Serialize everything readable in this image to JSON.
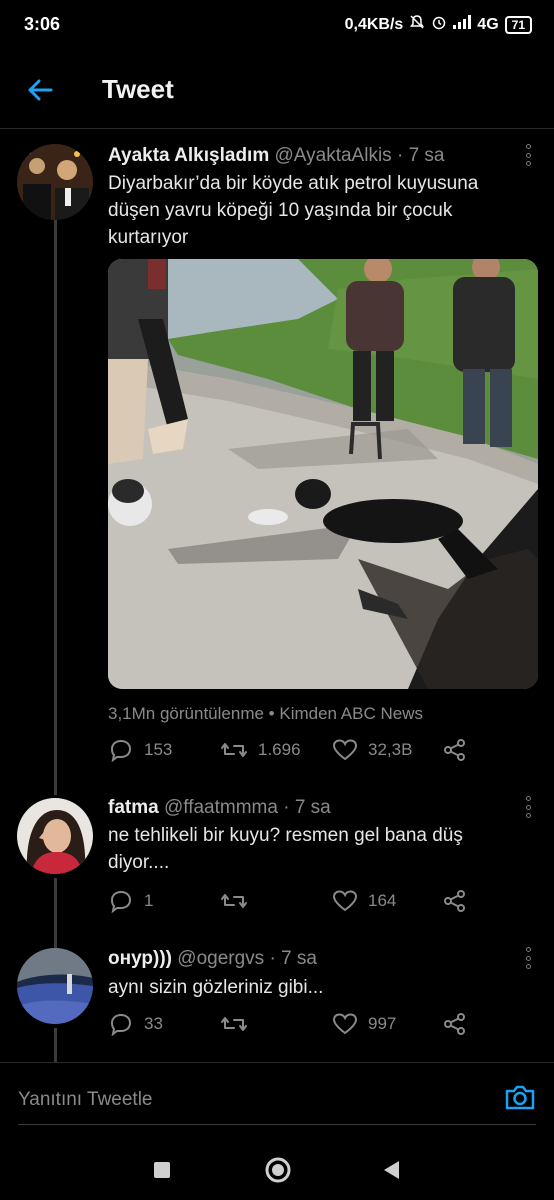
{
  "status_bar": {
    "time": "3:06",
    "net_speed": "0,4KB/s",
    "network": "4G",
    "battery": "71"
  },
  "header": {
    "title": "Tweet",
    "back_icon": "arrow-left-icon"
  },
  "colors": {
    "accent": "#1da1f2",
    "background": "#000000",
    "muted": "#8a8a8a"
  },
  "main_tweet": {
    "name": "Ayakta Alkışladım",
    "handle": "@AyaktaAlkis",
    "time": "7 sa",
    "text_lines": [
      "Diyarbakır’da bir köyde atık petrol kuyusuna",
      "düşen yavru köpeği 10 yaşında bir çocuk",
      "kurtarıyor"
    ],
    "views": "3,1Mn görüntülenme",
    "source": "Kimden ABC News",
    "replies": "153",
    "retweets": "1.696",
    "likes": "32,3B"
  },
  "replies": [
    {
      "name": "fatma",
      "handle": "@ffaatmmma",
      "time": "7 sa",
      "text_lines": [
        "ne tehlikeli bir kuyu? resmen gel bana düş",
        "diyor...."
      ],
      "replies": "1",
      "retweets": "",
      "likes": "164"
    },
    {
      "name": "онур)))",
      "handle": "@ogergvs",
      "time": "7 sa",
      "text_lines": [
        "aynı sizin gözleriniz gibi..."
      ],
      "replies": "33",
      "retweets": "",
      "likes": "997"
    }
  ],
  "composer": {
    "placeholder": "Yanıtını Tweetle"
  }
}
